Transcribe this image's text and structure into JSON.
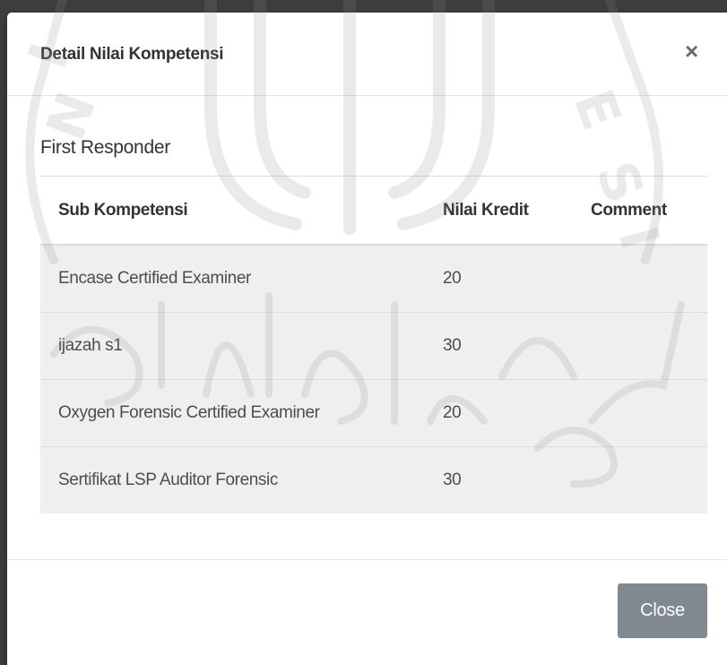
{
  "modal": {
    "title": "Detail Nilai Kompetensi",
    "close_icon_glyph": "×"
  },
  "section": {
    "title": "First Responder"
  },
  "table": {
    "headers": [
      "Sub Kompetensi",
      "Nilai Kredit",
      "Comment"
    ],
    "rows": [
      {
        "sub_kompetensi": "Encase Certified Examiner",
        "nilai_kredit": "20",
        "comment": ""
      },
      {
        "sub_kompetensi": "ijazah s1",
        "nilai_kredit": "30",
        "comment": ""
      },
      {
        "sub_kompetensi": "Oxygen Forensic Certified Examiner",
        "nilai_kredit": "20",
        "comment": ""
      },
      {
        "sub_kompetensi": "Sertifikat LSP Auditor Forensic",
        "nilai_kredit": "30",
        "comment": ""
      }
    ]
  },
  "footer": {
    "close_label": "Close"
  },
  "icons": {
    "close": "close-icon"
  },
  "colors": {
    "button_bg": "#808991",
    "row_bg": "#efefef",
    "backdrop": "#3d3d3d"
  }
}
